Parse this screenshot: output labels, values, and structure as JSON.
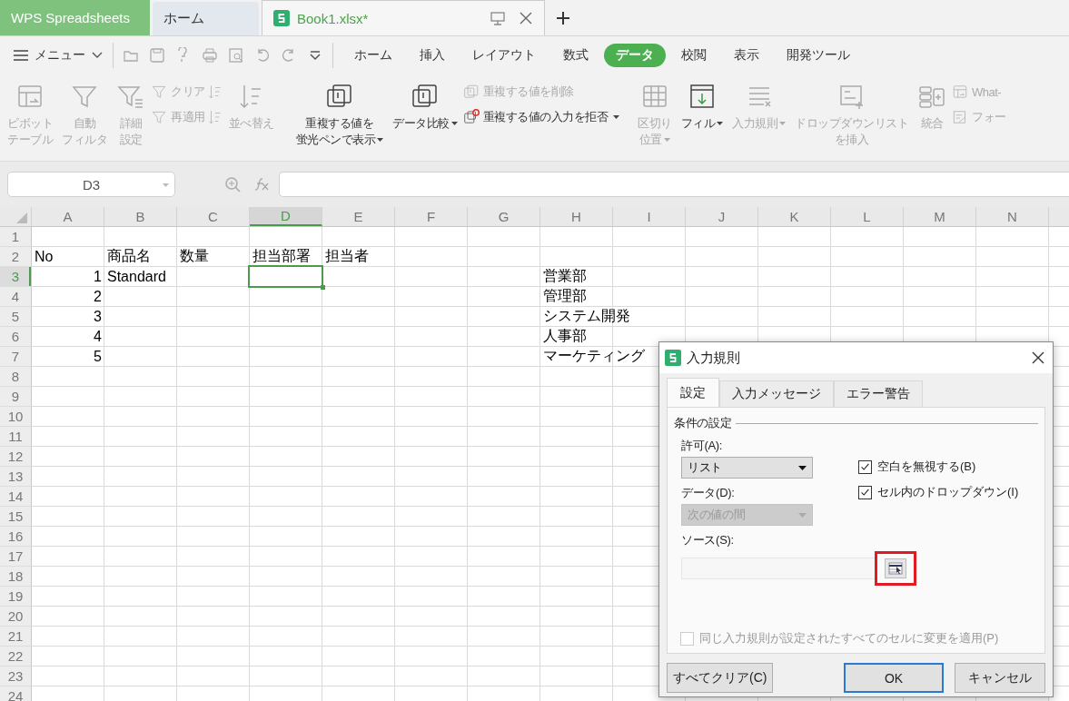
{
  "app_tabs": [
    {
      "label": "WPS Spreadsheets",
      "kind": "brand",
      "selected": false
    },
    {
      "label": "ホーム",
      "kind": "page",
      "selected": false
    },
    {
      "label": "Book1.xlsx*",
      "kind": "document",
      "selected": true
    }
  ],
  "menu": {
    "label": "メニュー"
  },
  "ribbon_tabs": [
    {
      "label": "ホーム",
      "selected": false
    },
    {
      "label": "挿入",
      "selected": false
    },
    {
      "label": "レイアウト",
      "selected": false
    },
    {
      "label": "数式",
      "selected": false
    },
    {
      "label": "データ",
      "selected": true
    },
    {
      "label": "校閲",
      "selected": false
    },
    {
      "label": "表示",
      "selected": false
    },
    {
      "label": "開発ツール",
      "selected": false
    }
  ],
  "ribbon": [
    {
      "kind": "large",
      "lines": [
        "ピボット",
        "テーブル"
      ],
      "disabled": true,
      "dropdown": false
    },
    {
      "kind": "large",
      "lines": [
        "自動",
        "フィルタ"
      ],
      "disabled": true,
      "dropdown": false
    },
    {
      "kind": "large",
      "lines": [
        "詳細",
        "設定"
      ],
      "disabled": true,
      "dropdown": false
    },
    {
      "kind": "stack",
      "items": [
        {
          "label": "クリア",
          "disabled": true,
          "dropdown": false
        },
        {
          "label": "再適用",
          "disabled": true,
          "dropdown": false
        }
      ]
    },
    {
      "kind": "stack",
      "items": [
        {
          "disabled": true,
          "dropdown": false
        },
        {
          "disabled": true,
          "dropdown": false
        }
      ]
    },
    {
      "kind": "large",
      "lines": [
        "並べ替え"
      ],
      "disabled": true,
      "dropdown": false
    },
    {
      "kind": "large",
      "lines": [
        "重複する値を",
        "蛍光ペンで表示"
      ],
      "disabled": false,
      "dropdown": true
    },
    {
      "kind": "large",
      "lines": [
        "データ比較"
      ],
      "disabled": false,
      "dropdown": true
    },
    {
      "kind": "stack",
      "items": [
        {
          "label": "重複する値を削除",
          "disabled": true,
          "dropdown": false
        },
        {
          "label": "重複する値の入力を拒否",
          "disabled": false,
          "dropdown": true
        }
      ]
    },
    {
      "kind": "large",
      "lines": [
        "区切り",
        "位置"
      ],
      "disabled": true,
      "dropdown": true
    },
    {
      "kind": "large",
      "lines": [
        "フィル"
      ],
      "disabled": false,
      "dropdown": true
    },
    {
      "kind": "large",
      "lines": [
        "入力規則"
      ],
      "disabled": true,
      "dropdown": true
    },
    {
      "kind": "large",
      "lines": [
        "ドロップダウンリスト",
        "を挿入"
      ],
      "disabled": true,
      "dropdown": false
    },
    {
      "kind": "large",
      "lines": [
        "統合"
      ],
      "disabled": true,
      "dropdown": false
    },
    {
      "kind": "stack",
      "items": [
        {
          "label": "What-",
          "disabled": true,
          "dropdown": false
        },
        {
          "label": "フォー",
          "disabled": true,
          "dropdown": false
        }
      ]
    }
  ],
  "name_box": "D3",
  "sheet": {
    "columns": [
      {
        "label": "A",
        "selected": false
      },
      {
        "label": "B",
        "selected": false
      },
      {
        "label": "C",
        "selected": false
      },
      {
        "label": "D",
        "selected": true
      },
      {
        "label": "E",
        "selected": false
      },
      {
        "label": "F",
        "selected": false
      },
      {
        "label": "G",
        "selected": false
      },
      {
        "label": "H",
        "selected": false
      },
      {
        "label": "I",
        "selected": false
      },
      {
        "label": "J",
        "selected": false
      },
      {
        "label": "K",
        "selected": false
      },
      {
        "label": "L",
        "selected": false
      },
      {
        "label": "M",
        "selected": false
      },
      {
        "label": "N",
        "selected": false
      }
    ],
    "rows": [
      {
        "label": "1",
        "selected": false
      },
      {
        "label": "2",
        "selected": false,
        "cells": [
          {
            "text": "No",
            "kind": "text",
            "selected": false
          },
          {
            "text": "商品名",
            "kind": "text",
            "selected": false
          },
          {
            "text": "数量",
            "kind": "text",
            "selected": false
          },
          {
            "text": "担当部署",
            "kind": "text",
            "selected": false
          },
          {
            "text": "担当者",
            "kind": "text",
            "selected": false
          }
        ]
      },
      {
        "label": "3",
        "selected": true,
        "cells": [
          {
            "text": "1",
            "kind": "number",
            "selected": false
          },
          {
            "text": "Standard",
            "kind": "text",
            "selected": false
          },
          null,
          {
            "selected": true
          },
          null,
          null,
          null,
          {
            "text": "営業部",
            "kind": "text",
            "selected": false
          }
        ]
      },
      {
        "label": "4",
        "selected": false,
        "cells": [
          {
            "text": "2",
            "kind": "number",
            "selected": false
          },
          null,
          null,
          null,
          null,
          null,
          null,
          {
            "text": "管理部",
            "kind": "text",
            "selected": false
          }
        ]
      },
      {
        "label": "5",
        "selected": false,
        "cells": [
          {
            "text": "3",
            "kind": "number",
            "selected": false
          },
          null,
          null,
          null,
          null,
          null,
          null,
          {
            "text": "システム開発",
            "kind": "text",
            "selected": false
          }
        ]
      },
      {
        "label": "6",
        "selected": false,
        "cells": [
          {
            "text": "4",
            "kind": "number",
            "selected": false
          },
          null,
          null,
          null,
          null,
          null,
          null,
          {
            "text": "人事部",
            "kind": "text",
            "selected": false
          }
        ]
      },
      {
        "label": "7",
        "selected": false,
        "cells": [
          {
            "text": "5",
            "kind": "number",
            "selected": false
          },
          null,
          null,
          null,
          null,
          null,
          null,
          {
            "text": "マーケティング",
            "kind": "text",
            "selected": false
          }
        ]
      },
      {
        "label": "8",
        "selected": false
      },
      {
        "label": "9",
        "selected": false
      },
      {
        "label": "10",
        "selected": false
      },
      {
        "label": "11",
        "selected": false
      },
      {
        "label": "12",
        "selected": false
      },
      {
        "label": "13",
        "selected": false
      },
      {
        "label": "14",
        "selected": false
      },
      {
        "label": "15",
        "selected": false
      },
      {
        "label": "16",
        "selected": false
      },
      {
        "label": "17",
        "selected": false
      },
      {
        "label": "18",
        "selected": false
      },
      {
        "label": "19",
        "selected": false
      },
      {
        "label": "20",
        "selected": false
      },
      {
        "label": "21",
        "selected": false
      },
      {
        "label": "22",
        "selected": false
      },
      {
        "label": "23",
        "selected": false
      },
      {
        "label": "24",
        "selected": false
      }
    ]
  },
  "dialog": {
    "title": "入力規則",
    "tabs": [
      {
        "label": "設定",
        "selected": true
      },
      {
        "label": "入力メッセージ",
        "selected": false
      },
      {
        "label": "エラー警告",
        "selected": false
      }
    ],
    "section": "条件の設定",
    "allow": {
      "label": "許可(A):",
      "value": "リスト",
      "disabled": false
    },
    "data": {
      "label": "データ(D):",
      "value": "次の値の間",
      "disabled": true
    },
    "options": [
      {
        "label": "空白を無視する(B)",
        "checked": true
      },
      {
        "label": "セル内のドロップダウン(I)",
        "checked": true
      }
    ],
    "source": {
      "label": "ソース(S):",
      "highlighted": true
    },
    "apply_all": {
      "label": "同じ入力規則が設定されたすべてのセルに変更を適用(P)",
      "checked": false,
      "disabled": true
    },
    "buttons": [
      {
        "label": "すべてクリア(C)",
        "kind": "normal"
      },
      {
        "label": "OK",
        "kind": "default"
      },
      {
        "label": "キャンセル",
        "kind": "normal"
      }
    ]
  }
}
